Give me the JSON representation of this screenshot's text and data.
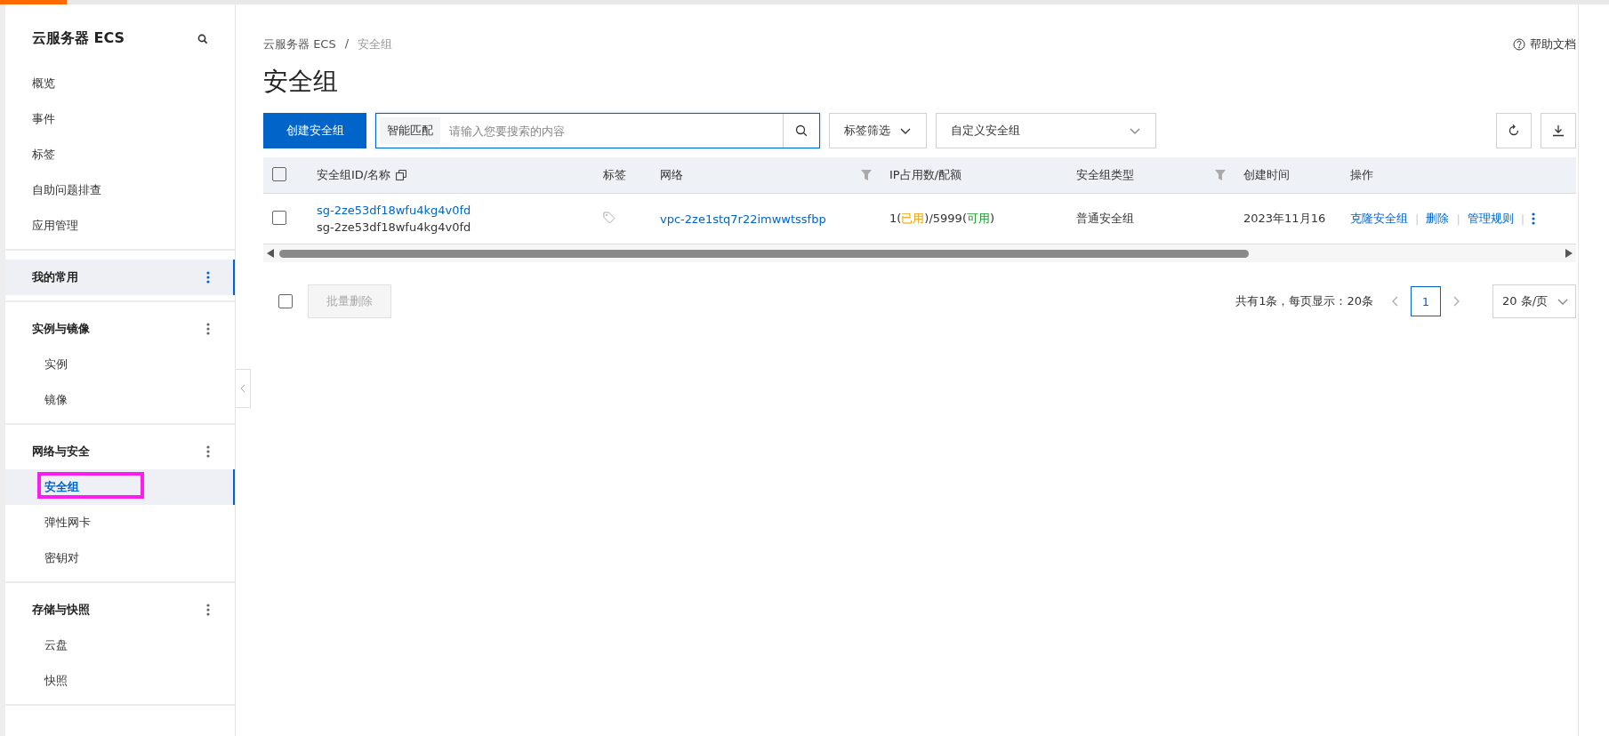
{
  "sidebar": {
    "title": "云服务器 ECS",
    "top_items": [
      {
        "label": "概览",
        "selected": false
      },
      {
        "label": "事件",
        "selected": false
      },
      {
        "label": "标签",
        "selected": false
      },
      {
        "label": "自助问题排查",
        "selected": false
      },
      {
        "label": "应用管理",
        "selected": false
      }
    ],
    "groups": [
      {
        "label": "我的常用",
        "selected": true
      },
      {
        "label": "实例与镜像",
        "selected": false,
        "items": [
          {
            "label": "实例",
            "selected": false,
            "annotated": false
          },
          {
            "label": "镜像",
            "selected": false,
            "annotated": false
          }
        ]
      },
      {
        "label": "网络与安全",
        "selected": false,
        "items": [
          {
            "label": "安全组",
            "selected": true,
            "annotated": true
          },
          {
            "label": "弹性网卡",
            "selected": false,
            "annotated": false
          },
          {
            "label": "密钥对",
            "selected": false,
            "annotated": false
          }
        ]
      },
      {
        "label": "存储与快照",
        "selected": false,
        "items": [
          {
            "label": "云盘",
            "selected": false,
            "annotated": false
          },
          {
            "label": "快照",
            "selected": false,
            "annotated": false
          }
        ]
      }
    ]
  },
  "breadcrumb": [
    "云服务器 ECS",
    "/",
    "安全组"
  ],
  "help_link": "帮助文档",
  "page_title": "安全组",
  "toolbar": {
    "create_button": "创建安全组",
    "search_mode": "智能匹配",
    "search_placeholder": "请输入您要搜索的内容",
    "tag_filter": "标签筛选",
    "group_select": "自定义安全组"
  },
  "table": {
    "header_checked": false,
    "columns": [
      {
        "label": "安全组ID/名称",
        "kind": "copy"
      },
      {
        "label": "标签",
        "kind": "plain"
      },
      {
        "label": "网络",
        "kind": "filter"
      },
      {
        "label": "IP占用数/配额",
        "kind": "plain"
      },
      {
        "label": "安全组类型",
        "kind": "filter"
      },
      {
        "label": "创建时间",
        "kind": "plain"
      },
      {
        "label": "操作",
        "kind": "plain"
      }
    ],
    "rows": [
      {
        "checked": false,
        "id": "sg-2ze53df18wfu4kg4v0fd",
        "name": "sg-2ze53df18wfu4kg4v0fd",
        "network": "vpc-2ze1stq7r22imwwtssfbp",
        "ip_usage": [
          {
            "text": "1(",
            "kind": "plain"
          },
          {
            "text": "已用",
            "kind": "used"
          },
          {
            "text": ")/5999(",
            "kind": "plain"
          },
          {
            "text": "可用",
            "kind": "available"
          },
          {
            "text": ")",
            "kind": "plain"
          }
        ],
        "type": "普通安全组",
        "created": "2023年11月16",
        "actions": [
          "克隆安全组",
          "|",
          "删除",
          "|",
          "管理规则",
          "|"
        ]
      }
    ]
  },
  "footer": {
    "checked": false,
    "batch_delete": "批量删除",
    "summary": "共有1条，每页显示：20条",
    "pages": [
      {
        "label": "1",
        "selected": true
      }
    ],
    "page_size": "20 条/页"
  }
}
